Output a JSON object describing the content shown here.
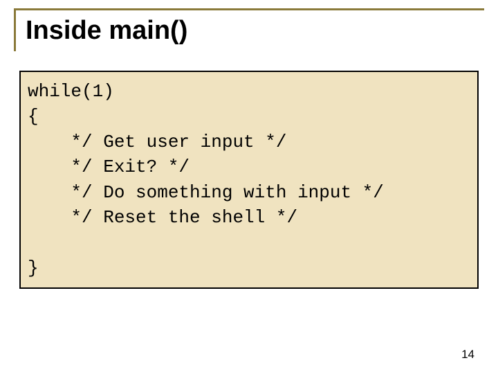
{
  "slide": {
    "title": "Inside main()",
    "code": {
      "line1": "while(1)",
      "line2": "{",
      "line3": "    */ Get user input */",
      "line4": "    */ Exit? */",
      "line5": "    */ Do something with input */",
      "line6": "    */ Reset the shell */",
      "line7": "",
      "line8": "}"
    },
    "page_number": "14"
  }
}
